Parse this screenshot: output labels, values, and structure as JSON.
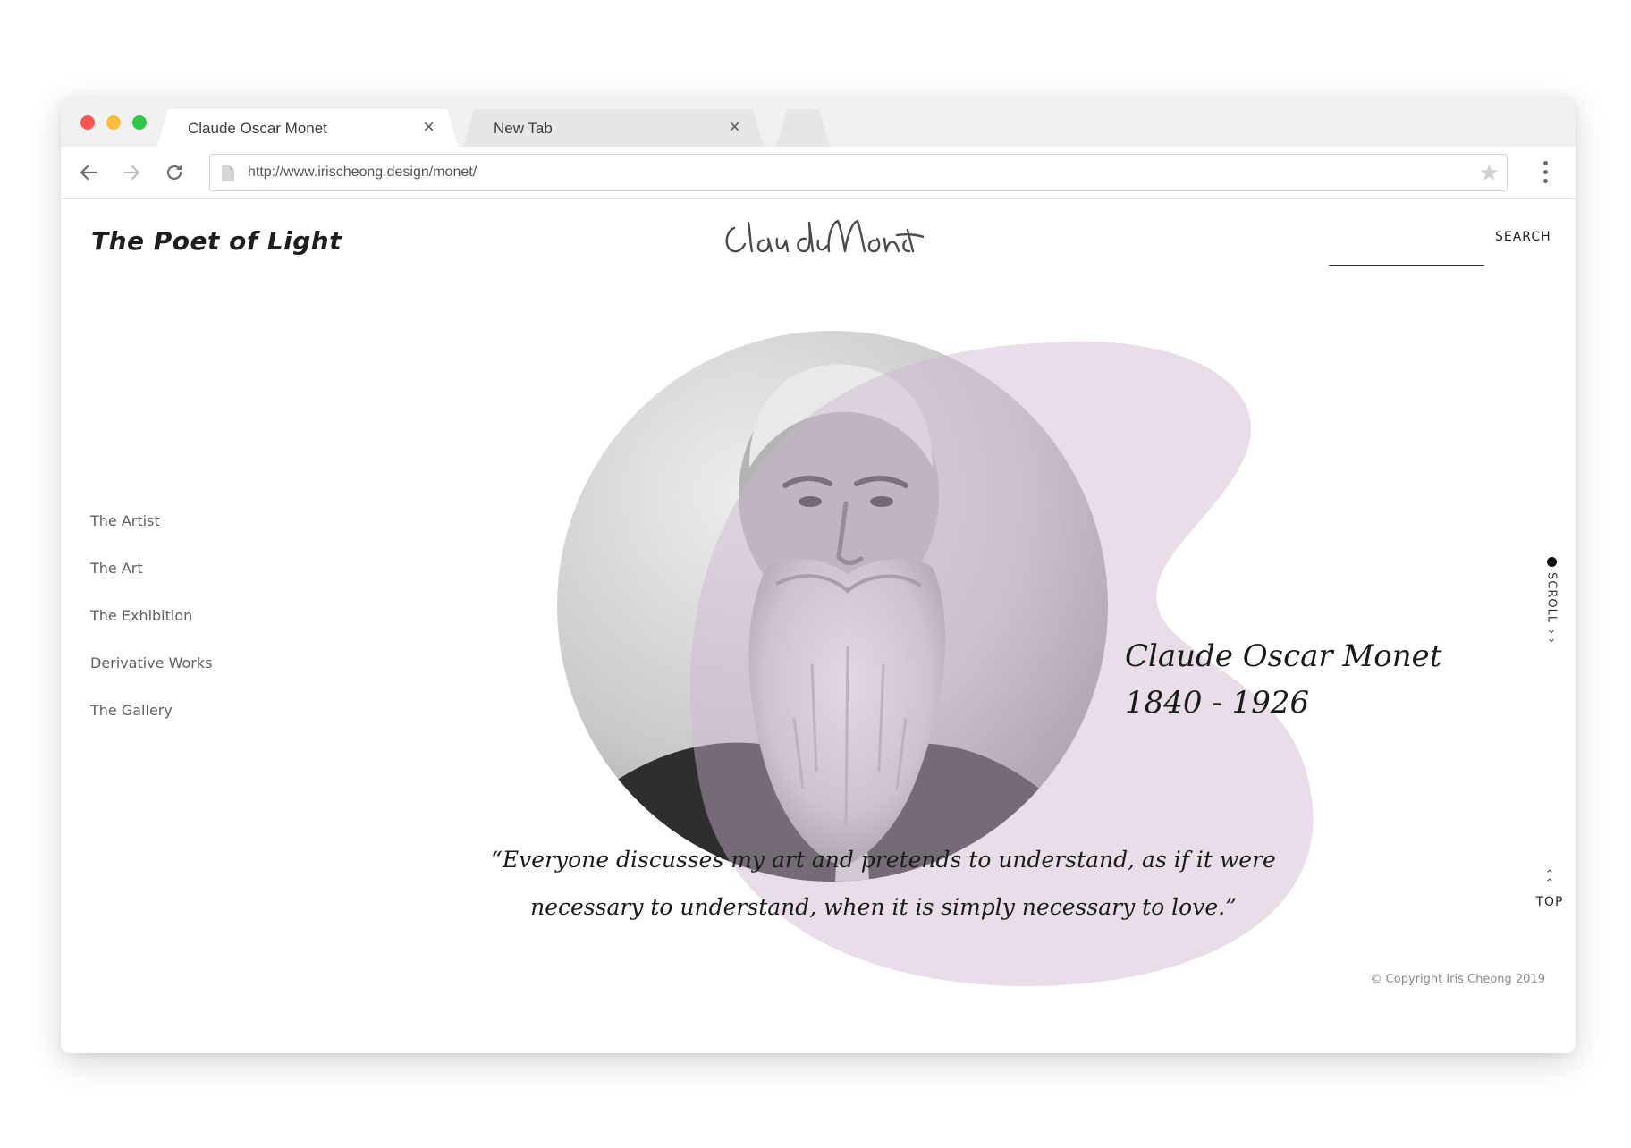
{
  "browser": {
    "tabs": [
      {
        "title": "Claude Oscar Monet",
        "close": "×",
        "active": true
      },
      {
        "title": "New Tab",
        "close": "×",
        "active": false
      }
    ],
    "url": "http://www.irischeong.design/monet/",
    "traffic_colors": {
      "close": "#fc5753",
      "minimize": "#fdbc40",
      "maximize": "#33c748"
    }
  },
  "site": {
    "tagline": "The Poet of Light",
    "signature_icon": "claude-monet-signature",
    "search_label": "SEARCH",
    "search_value": "",
    "nav": [
      {
        "label": "The Artist"
      },
      {
        "label": "The Art"
      },
      {
        "label": "The Exhibition"
      },
      {
        "label": "Derivative Works"
      },
      {
        "label": "The Gallery"
      }
    ],
    "hero": {
      "name": "Claude Oscar Monet",
      "years": "1840 - 1926",
      "quote_line1": "“Everyone discusses my art and pretends to understand, as if it were",
      "quote_line2": "necessary to understand, when it is simply necessary to love.”",
      "blob_color": "#e8dde9",
      "portrait_icon": "monet-portrait-photo"
    },
    "scroll_label": "SCROLL",
    "top_label": "TOP",
    "copyright": "© Copyright Iris Cheong 2019"
  }
}
